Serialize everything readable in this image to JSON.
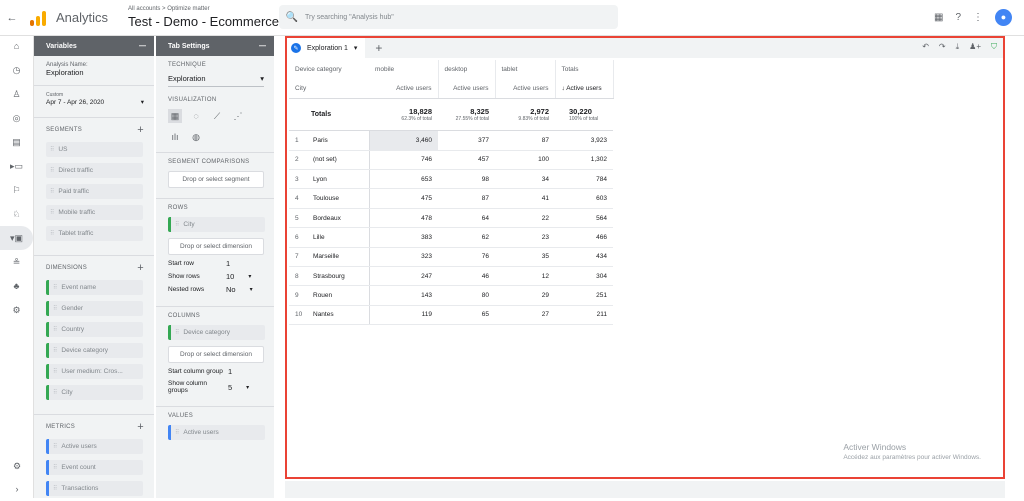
{
  "app": {
    "name": "Analytics",
    "breadcrumb": "All accounts > Optimize matter",
    "property": "Test - Demo - Ecommerce ▾"
  },
  "search": {
    "placeholder": "Try searching \"Analysis hub\""
  },
  "user": {
    "initial": "👤"
  },
  "variables": {
    "title": "Variables",
    "analysis_label": "Analysis Name:",
    "analysis_name": "Exploration",
    "date_label": "Custom",
    "date_value": "Apr 7 - Apr 26, 2020",
    "segments_title": "SEGMENTS",
    "segments": [
      "US",
      "Direct traffic",
      "Paid traffic",
      "Mobile traffic",
      "Tablet traffic"
    ],
    "dimensions_title": "DIMENSIONS",
    "dimensions": [
      "Event name",
      "Gender",
      "Country",
      "Device category",
      "User medium: Cros...",
      "City"
    ],
    "metrics_title": "METRICS",
    "metrics": [
      "Active users",
      "Event count",
      "Transactions"
    ]
  },
  "tab_settings": {
    "title": "Tab Settings",
    "technique_label": "TECHNIQUE",
    "technique": "Exploration",
    "viz_label": "VISUALIZATION",
    "segment_comp_label": "SEGMENT COMPARISONS",
    "segment_drop": "Drop or select segment",
    "rows_label": "ROWS",
    "rows_chip": "City",
    "dimension_drop": "Drop or select dimension",
    "start_row_label": "Start row",
    "start_row": "1",
    "show_rows_label": "Show rows",
    "show_rows": "10",
    "nested_rows_label": "Nested rows",
    "nested_rows": "No",
    "columns_label": "COLUMNS",
    "columns_chip": "Device category",
    "start_col_label": "Start column group",
    "start_col": "1",
    "show_col_label": "Show column groups",
    "show_col": "5",
    "values_label": "VALUES",
    "values_chip": "Active users"
  },
  "exploration": {
    "tab_name": "Exploration 1",
    "header_dim": "Device category",
    "columns": [
      "mobile",
      "desktop",
      "tablet",
      "Totals"
    ],
    "row_dim": "City",
    "metric_labels": [
      "Active users",
      "Active users",
      "Active users",
      "↓ Active users"
    ],
    "totals_label": "Totals",
    "totals": [
      "18,828",
      "8,325",
      "2,972",
      "30,220"
    ],
    "totals_pct": [
      "62.3% of total",
      "27.55% of total",
      "9.83% of total",
      "100% of total"
    ],
    "rows": [
      {
        "i": "1",
        "city": "Paris",
        "v": [
          "3,460",
          "377",
          "87",
          "3,923"
        ]
      },
      {
        "i": "2",
        "city": "(not set)",
        "v": [
          "746",
          "457",
          "100",
          "1,302"
        ]
      },
      {
        "i": "3",
        "city": "Lyon",
        "v": [
          "653",
          "98",
          "34",
          "784"
        ]
      },
      {
        "i": "4",
        "city": "Toulouse",
        "v": [
          "475",
          "87",
          "41",
          "603"
        ]
      },
      {
        "i": "5",
        "city": "Bordeaux",
        "v": [
          "478",
          "64",
          "22",
          "564"
        ]
      },
      {
        "i": "6",
        "city": "Lille",
        "v": [
          "383",
          "62",
          "23",
          "466"
        ]
      },
      {
        "i": "7",
        "city": "Marseille",
        "v": [
          "323",
          "76",
          "35",
          "434"
        ]
      },
      {
        "i": "8",
        "city": "Strasbourg",
        "v": [
          "247",
          "46",
          "12",
          "304"
        ]
      },
      {
        "i": "9",
        "city": "Rouen",
        "v": [
          "143",
          "80",
          "29",
          "251"
        ]
      },
      {
        "i": "10",
        "city": "Nantes",
        "v": [
          "119",
          "65",
          "27",
          "211"
        ]
      }
    ]
  },
  "watermark": {
    "line1": "Activer Windows",
    "line2": "Accédez aux paramètres pour activer Windows."
  }
}
